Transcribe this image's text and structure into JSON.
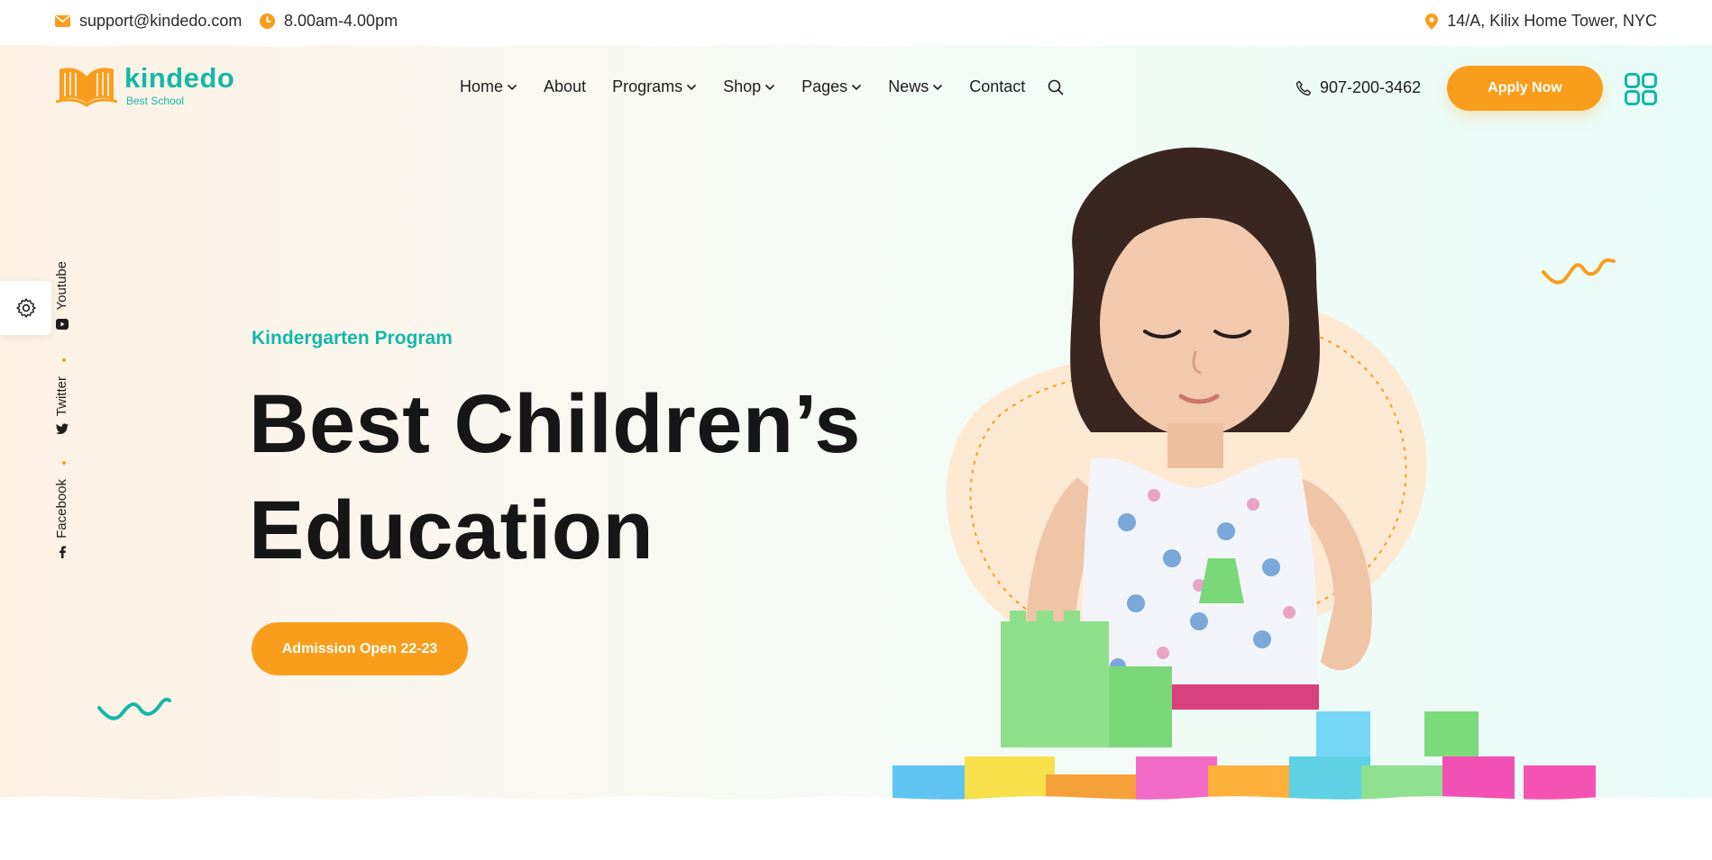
{
  "topbar": {
    "email": "support@kindedo.com",
    "hours": "8.00am-4.00pm",
    "address": "14/A, Kilix Home Tower, NYC"
  },
  "brand": {
    "name": "kindedo",
    "tagline": "Best School"
  },
  "nav": {
    "items": [
      {
        "label": "Home",
        "dropdown": true
      },
      {
        "label": "About",
        "dropdown": false
      },
      {
        "label": "Programs",
        "dropdown": true
      },
      {
        "label": "Shop",
        "dropdown": true
      },
      {
        "label": "Pages",
        "dropdown": true
      },
      {
        "label": "News",
        "dropdown": true
      },
      {
        "label": "Contact",
        "dropdown": false
      }
    ]
  },
  "header": {
    "phone": "907-200-3462",
    "apply_label": "Apply Now"
  },
  "social": {
    "youtube": "Youtube",
    "twitter": "Twitter",
    "facebook": "Facebook"
  },
  "hero": {
    "eyebrow": "Kindergarten Program",
    "headline_line1": "Best Children’s",
    "headline_line2": "Education",
    "cta_label": "Admission Open 22-23"
  },
  "colors": {
    "accent_orange": "#f99e1c",
    "accent_teal": "#14b8a6",
    "text_dark": "#161616"
  },
  "icons": [
    "mail-icon",
    "clock-icon",
    "map-pin-icon",
    "chevron-down-icon",
    "search-icon",
    "phone-icon",
    "grid-menu-icon",
    "gear-icon",
    "youtube-icon",
    "twitter-icon",
    "facebook-icon",
    "book-logo-icon"
  ]
}
